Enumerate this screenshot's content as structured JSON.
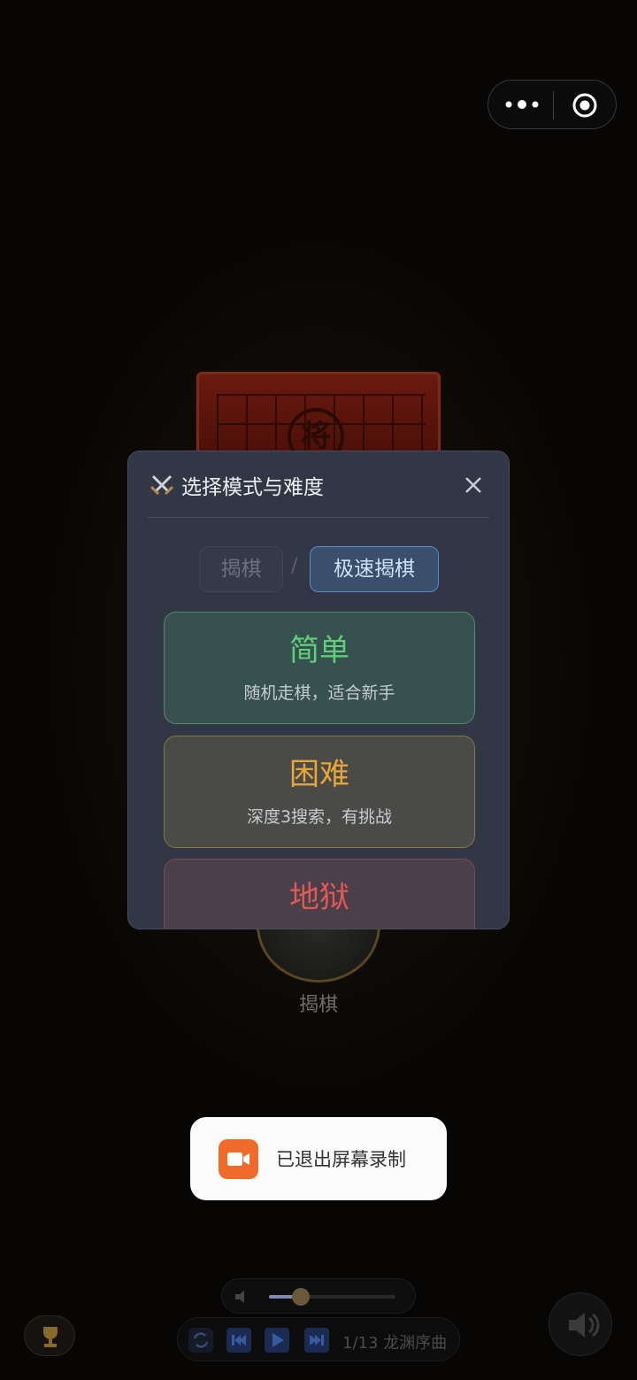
{
  "modal": {
    "title": "选择模式与难度",
    "tabs": [
      "揭棋",
      "极速揭棋"
    ],
    "tab_separator": "/",
    "difficulties": [
      {
        "title": "简单",
        "desc": "随机走棋，适合新手"
      },
      {
        "title": "困难",
        "desc": "深度3搜索，有挑战"
      },
      {
        "title": "地狱",
        "desc": ""
      }
    ]
  },
  "board": {
    "piece": "将"
  },
  "mode_label": "揭棋",
  "toast": {
    "text": "已退出屏幕录制"
  },
  "player": {
    "track": "1/13 龙渊序曲"
  },
  "volume": {
    "level": 0.25
  },
  "colors": {
    "accent_blue": "#5a8ad0",
    "easy": "#5fcf7a",
    "hard": "#e8a53a",
    "hell": "#e15a52",
    "toast_icon": "#f06a2a"
  }
}
